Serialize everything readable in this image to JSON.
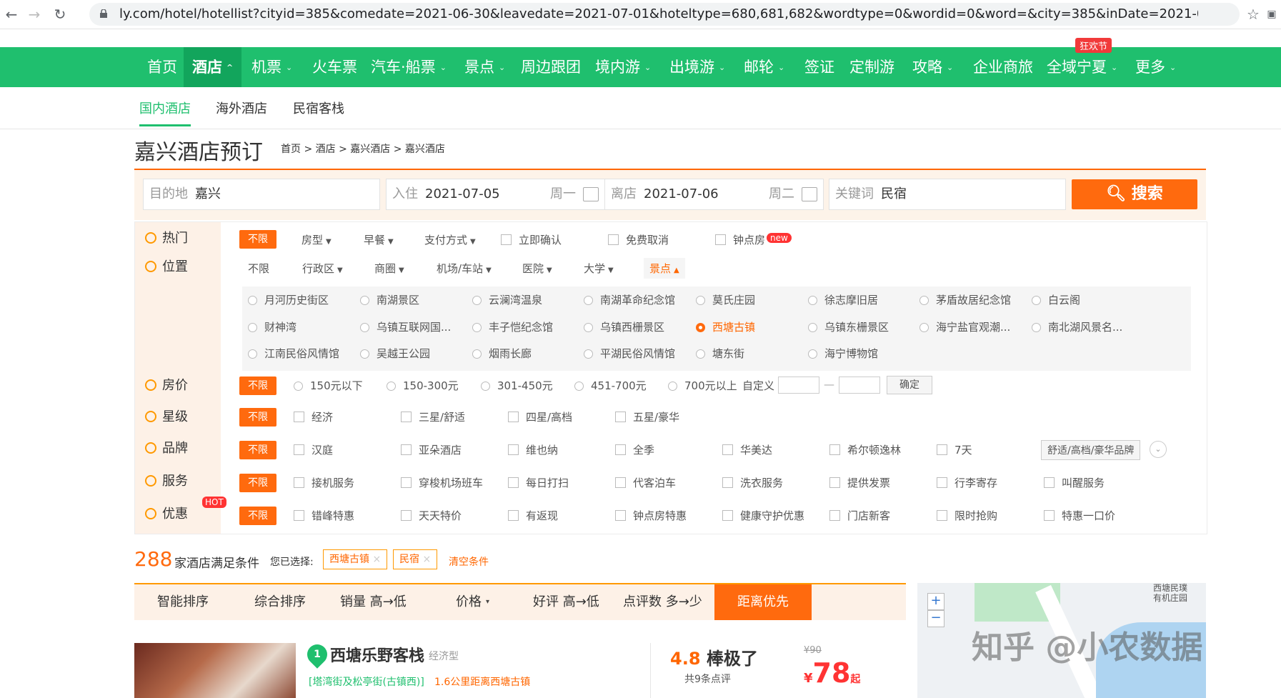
{
  "browser": {
    "url": "ly.com/hotel/hotellist?cityid=385&comedate=2021-06-30&leavedate=2021-07-01&hoteltype=680,681,682&wordtype=0&wordid=0&word=&city=385&inDate=2021-07-05&out..."
  },
  "nav": {
    "items": [
      "首页",
      "酒店",
      "机票",
      "火车票",
      "汽车·船票",
      "景点",
      "周边跟团",
      "境内游",
      "出境游",
      "邮轮",
      "签证",
      "定制游",
      "攻略",
      "企业商旅",
      "全域宁夏",
      "更多"
    ],
    "promo_badge": "狂欢节"
  },
  "subtabs": [
    "国内酒店",
    "海外酒店",
    "民宿客栈"
  ],
  "page": {
    "title": "嘉兴酒店预订",
    "breadcrumb": "首页 > 酒店 > 嘉兴酒店 > 嘉兴酒店"
  },
  "search": {
    "dest_label": "目的地",
    "dest_value": "嘉兴",
    "checkin_label": "入住",
    "checkin_value": "2021-07-05",
    "checkin_week": "周一",
    "checkout_label": "离店",
    "checkout_value": "2021-07-06",
    "checkout_week": "周二",
    "keyword_label": "关键词",
    "keyword_value": "民宿",
    "button": "搜索"
  },
  "filters": {
    "unlimited": "不限",
    "hot": {
      "label": "热门",
      "dropdowns": [
        "房型",
        "早餐",
        "支付方式"
      ],
      "checks": [
        "立即确认",
        "免费取消",
        "钟点房"
      ],
      "new_badge": "new"
    },
    "location": {
      "label": "位置",
      "tabs": [
        "不限",
        "行政区",
        "商圈",
        "机场/车站",
        "医院",
        "大学",
        "景点"
      ],
      "spots": [
        "月河历史街区",
        "南湖景区",
        "云澜湾温泉",
        "南湖革命纪念馆",
        "莫氏庄园",
        "徐志摩旧居",
        "茅盾故居纪念馆",
        "白云阁",
        "财神湾",
        "乌镇互联网国...",
        "丰子恺纪念馆",
        "乌镇西栅景区",
        "西塘古镇",
        "乌镇东栅景区",
        "海宁盐官观潮...",
        "南北湖风景名...",
        "江南民俗风情馆",
        "吴越王公园",
        "烟雨长廊",
        "平湖民俗风情馆",
        "塘东街",
        "海宁博物馆"
      ],
      "selected": "西塘古镇"
    },
    "price": {
      "label": "房价",
      "options": [
        "150元以下",
        "150-300元",
        "301-450元",
        "451-700元",
        "700元以上"
      ],
      "custom": "自定义",
      "dash": "—",
      "ok": "确定"
    },
    "star": {
      "label": "星级",
      "options": [
        "经济",
        "三星/舒适",
        "四星/高档",
        "五星/豪华"
      ]
    },
    "brand": {
      "label": "品牌",
      "options": [
        "汉庭",
        "亚朵酒店",
        "维也纳",
        "全季",
        "华美达",
        "希尔顿逸林",
        "7天"
      ],
      "select": "舒适/高档/豪华品牌"
    },
    "service": {
      "label": "服务",
      "options": [
        "接机服务",
        "穿梭机场班车",
        "每日打扫",
        "代客泊车",
        "洗衣服务",
        "提供发票",
        "行李寄存",
        "叫醒服务"
      ]
    },
    "discount": {
      "label": "优惠",
      "badge": "HOT",
      "options": [
        "错峰特惠",
        "天天特价",
        "有返现",
        "钟点房特惠",
        "健康守护优惠",
        "门店新客",
        "限时抢购",
        "特惠一口价"
      ]
    }
  },
  "results": {
    "count": "288",
    "count_text": "家酒店满足条件",
    "chosen_label": "您已选择:",
    "tags": [
      "西塘古镇",
      "民宿"
    ],
    "clear": "清空条件"
  },
  "sort": [
    "智能排序",
    "综合排序",
    "销量 高→低",
    "价格",
    "好评 高→低",
    "点评数 多→少",
    "距离优先"
  ],
  "hotel": {
    "index": "1",
    "name": "西塘乐野客栈",
    "type": "经济型",
    "address": "[塔湾街及松亭街(古镇西)]",
    "distance": "1.6公里距离西塘古镇",
    "score": "4.8",
    "score_text": "棒极了",
    "reviews": "共9条点评",
    "old_price": "¥90",
    "currency": "¥",
    "price": "78",
    "price_suffix": "起"
  },
  "map": {
    "label_line1": "西塘民璞",
    "label_line2": "有机庄园",
    "zoom_in": "+",
    "zoom_out": "−"
  },
  "watermark": "知乎 @小农数据"
}
